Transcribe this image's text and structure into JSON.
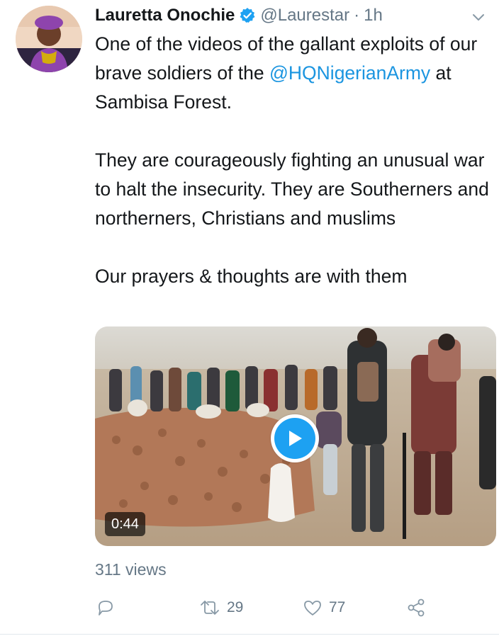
{
  "tweet": {
    "author_name": "Lauretta Onochie",
    "handle": "@Laurestar",
    "separator": "·",
    "time": "1h",
    "text_line1": "One of  the videos of the gallant exploits of our brave soldiers of the",
    "mention": "@HQNigerianArmy",
    "text_line1_end": " at Sambisa Forest.",
    "paragraph2": "They are courageously fighting an unusual war to halt the insecurity. They are Southerners and northerners, Christians and muslims",
    "paragraph3": "Our prayers & thoughts are with them"
  },
  "video": {
    "duration": "0:44"
  },
  "stats": {
    "views": "311 views"
  },
  "actions": {
    "retweets": "29",
    "likes": "77"
  },
  "colors": {
    "accent": "#1da1f2",
    "link": "#1b95e0",
    "muted": "#657786"
  },
  "icons": {
    "verified": "verified-badge-icon",
    "chevron": "chevron-down-icon",
    "play": "play-icon",
    "reply": "reply-icon",
    "retweet": "retweet-icon",
    "like": "heart-icon",
    "share": "share-icon"
  }
}
